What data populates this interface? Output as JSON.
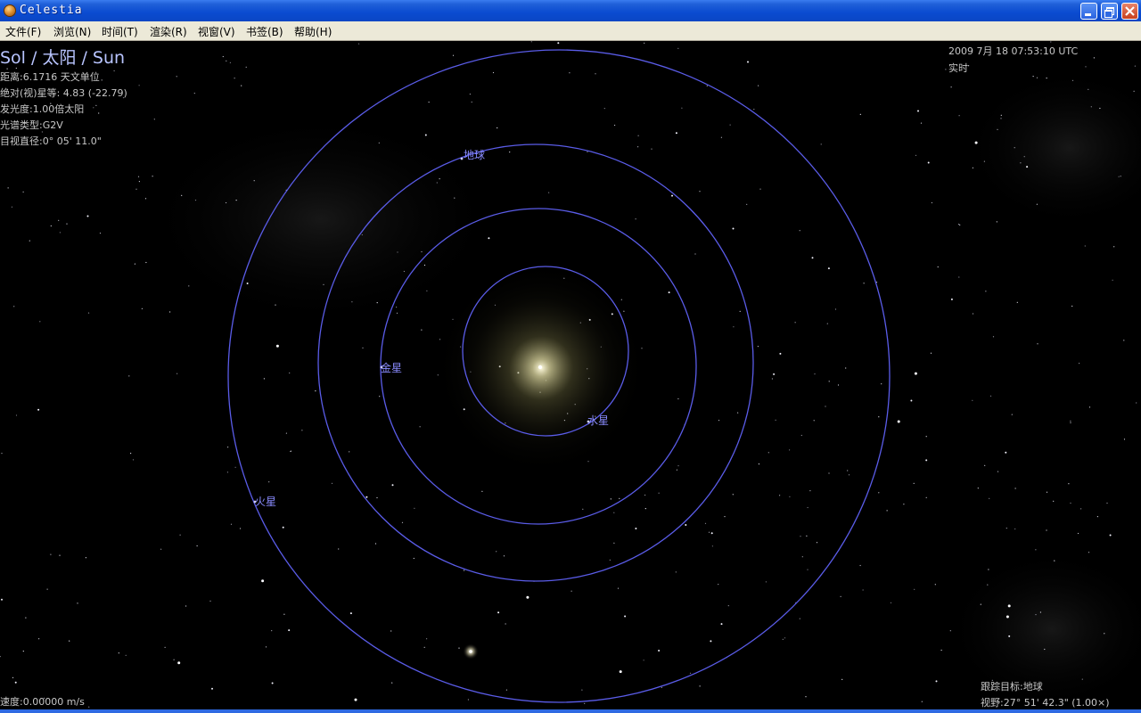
{
  "window": {
    "title": "Celestia",
    "colors": {
      "titlebar": "#0a4bd0",
      "menubar": "#ece9d8",
      "orbit": "#5a5ce8",
      "label": "#8a8cff"
    }
  },
  "menu": [
    {
      "label": "文件(F)"
    },
    {
      "label": "浏览(N)"
    },
    {
      "label": "时间(T)"
    },
    {
      "label": "渲染(R)"
    },
    {
      "label": "视窗(V)"
    },
    {
      "label": "书签(B)"
    },
    {
      "label": "帮助(H)"
    }
  ],
  "object_info": {
    "name": "Sol / 太阳 / Sun",
    "distance": "距离:6.1716 天文单位",
    "magnitude": "绝对(视)星等: 4.83 (-22.79)",
    "luminosity": "发光度:1.00倍太阳",
    "spectral_type": "光谱类型:G2V",
    "apparent_diameter": "目视直径:0° 05' 11.0\""
  },
  "time_info": {
    "datetime": "2009 7月 18 07:53:10 UTC",
    "rate": "实时"
  },
  "orbit_labels": {
    "mercury": "水星",
    "venus": "金星",
    "earth": "地球",
    "mars": "火星"
  },
  "status": {
    "speed": "速度:0.00000 m/s",
    "track_target": "跟踪目标:地球",
    "fov": "视野:27° 51' 42.3\" (1.00×)"
  }
}
